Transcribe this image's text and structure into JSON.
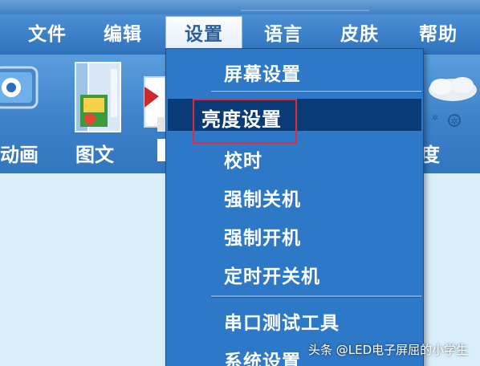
{
  "menubar": {
    "items": [
      {
        "label": "文件"
      },
      {
        "label": "编辑"
      },
      {
        "label": "设置"
      },
      {
        "label": "语言"
      },
      {
        "label": "皮肤"
      },
      {
        "label": "帮助"
      }
    ]
  },
  "toolbar": {
    "items": [
      {
        "label": "动画",
        "icon": "animation-icon"
      },
      {
        "label": "图文",
        "icon": "image-text-icon"
      },
      {
        "label": "度",
        "icon": "weather-icon"
      }
    ]
  },
  "settings_menu": {
    "items": [
      {
        "label": "屏幕设置"
      },
      {
        "label": "亮度设置",
        "highlighted": true
      },
      {
        "label": "校时"
      },
      {
        "label": "强制关机"
      },
      {
        "label": "强制开机"
      },
      {
        "label": "定时开关机"
      },
      {
        "label": "串口测试工具"
      },
      {
        "label": "系统设置"
      }
    ]
  },
  "watermark": "头条 @LED电子屏屈的小学生",
  "colors": {
    "menubar": "#2e72bd",
    "dropdown": "#2e78c8",
    "highlight": "#0b3b77",
    "callout": "#e22a3a"
  }
}
